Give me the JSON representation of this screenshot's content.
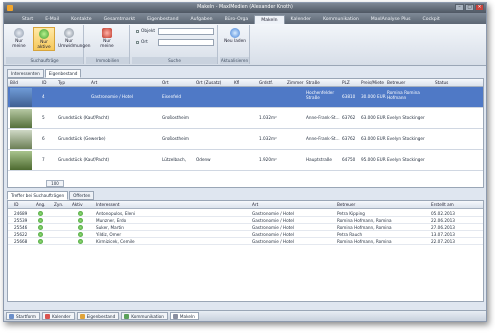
{
  "window": {
    "title": "Makeln - MaxIMedien (Alexander Knoth)",
    "min": "–",
    "max": "□",
    "close": "✕"
  },
  "menu": [
    "Start",
    "E-Mail",
    "Kontakte",
    "Gesamtmarkt",
    "Eigenbestand",
    "Aufgaben",
    "Büro-Orga",
    "Makeln",
    "Kalender",
    "Kommunikation",
    "MaxIAnalyse Plus",
    "Cockpit"
  ],
  "ribbon": {
    "g1": {
      "label": "Suchaufträge",
      "b1": "Nur meine",
      "b2": "Nur aktive",
      "b3": "Nur Umwidmungen"
    },
    "g2": {
      "label": "Immobilien",
      "b1": "Nur meine"
    },
    "g3": {
      "label": "Suche",
      "objekt": "Objekt",
      "ort": "Ort"
    },
    "g4": {
      "label": "Aktualisieren",
      "b1": "Neu laden"
    }
  },
  "subtabs": [
    "Interessenten",
    "Eigenbestand"
  ],
  "table1": {
    "headers": [
      "Bild",
      "ID",
      "Typ",
      "Art",
      "Ort",
      "Ort (Zusatz)",
      "Kfl",
      "Grdstf.",
      "Zimmer",
      "Straße",
      "PLZ",
      "Preis/Miete",
      "Betreuer",
      "Status"
    ],
    "rows": [
      {
        "id": "4",
        "typ": "",
        "art": "Gastronomie / Hotel",
        "ort": "Eisenfeld",
        "zus": "",
        "grd": "",
        "str": "Hochenfelder Straße",
        "plz": "63810",
        "preis": "30.000 EUR",
        "betr": "Romina Romina Hofmann",
        "status": ""
      },
      {
        "id": "5",
        "typ": "Grundstück (Kauf/Pacht)",
        "art": "",
        "ort": "Großostheim",
        "zus": "",
        "grd": "1.032m²",
        "str": "Anne-Frank-St...",
        "plz": "63762",
        "preis": "63.000 EUR",
        "betr": "Evelyn Stockinger",
        "status": ""
      },
      {
        "id": "6",
        "typ": "Grundstück (Gewerbe)",
        "art": "",
        "ort": "Großostheim",
        "zus": "",
        "grd": "1.032m²",
        "str": "Anne-Frank-St...",
        "plz": "63762",
        "preis": "63.000 EUR",
        "betr": "Evelyn Stockinger",
        "status": ""
      },
      {
        "id": "7",
        "typ": "Grundstück (Kauf/Pacht)",
        "art": "",
        "ort": "Lützelbach,",
        "zus": "Odenw",
        "grd": "1.920m²",
        "str": "Hauptstraße",
        "plz": "64750",
        "preis": "95.000 EUR",
        "betr": "Evelyn Stockinger",
        "status": ""
      }
    ],
    "count": "100"
  },
  "tabs2": [
    "Treffer bei Suchaufträgen",
    "Offerten"
  ],
  "table2": {
    "headers": [
      "ID",
      "Ang.",
      "Zyn.",
      "Aktiv",
      "Interessent",
      "Art",
      "Betreuer",
      "Erstellt am"
    ],
    "rows": [
      {
        "id": "24689",
        "name": "Antonopulos, Eleni",
        "art": "Gastronomie / Hotel",
        "betr": "Petra Kipping",
        "date": "05.02.2013"
      },
      {
        "id": "25539",
        "name": "Munzner, Erdo",
        "art": "Gastronomie / Hotel",
        "betr": "Romina Hofmann, Romina",
        "date": "22.06.2013"
      },
      {
        "id": "25546",
        "name": "Suker, Martin",
        "art": "Gastronomie / Hotel",
        "betr": "Romina Hofmann, Romina",
        "date": "27.06.2013"
      },
      {
        "id": "25622",
        "name": "Yildiz, Omer",
        "art": "Gastronomie / Hotel",
        "betr": "Petra Rauch",
        "date": "13.07.2013"
      },
      {
        "id": "25668",
        "name": "Kirmizicek, Cemile",
        "art": "Gastronomie / Hotel",
        "betr": "Romina Hofmann, Romina",
        "date": "22.07.2013"
      }
    ]
  },
  "statusbar": [
    "Startform",
    "Kalender",
    "Eigenbestand",
    "Kommunikation",
    "Makeln"
  ],
  "colors": {
    "accent": "#4f79c6",
    "ribbon_sel": "#f6c85a"
  }
}
